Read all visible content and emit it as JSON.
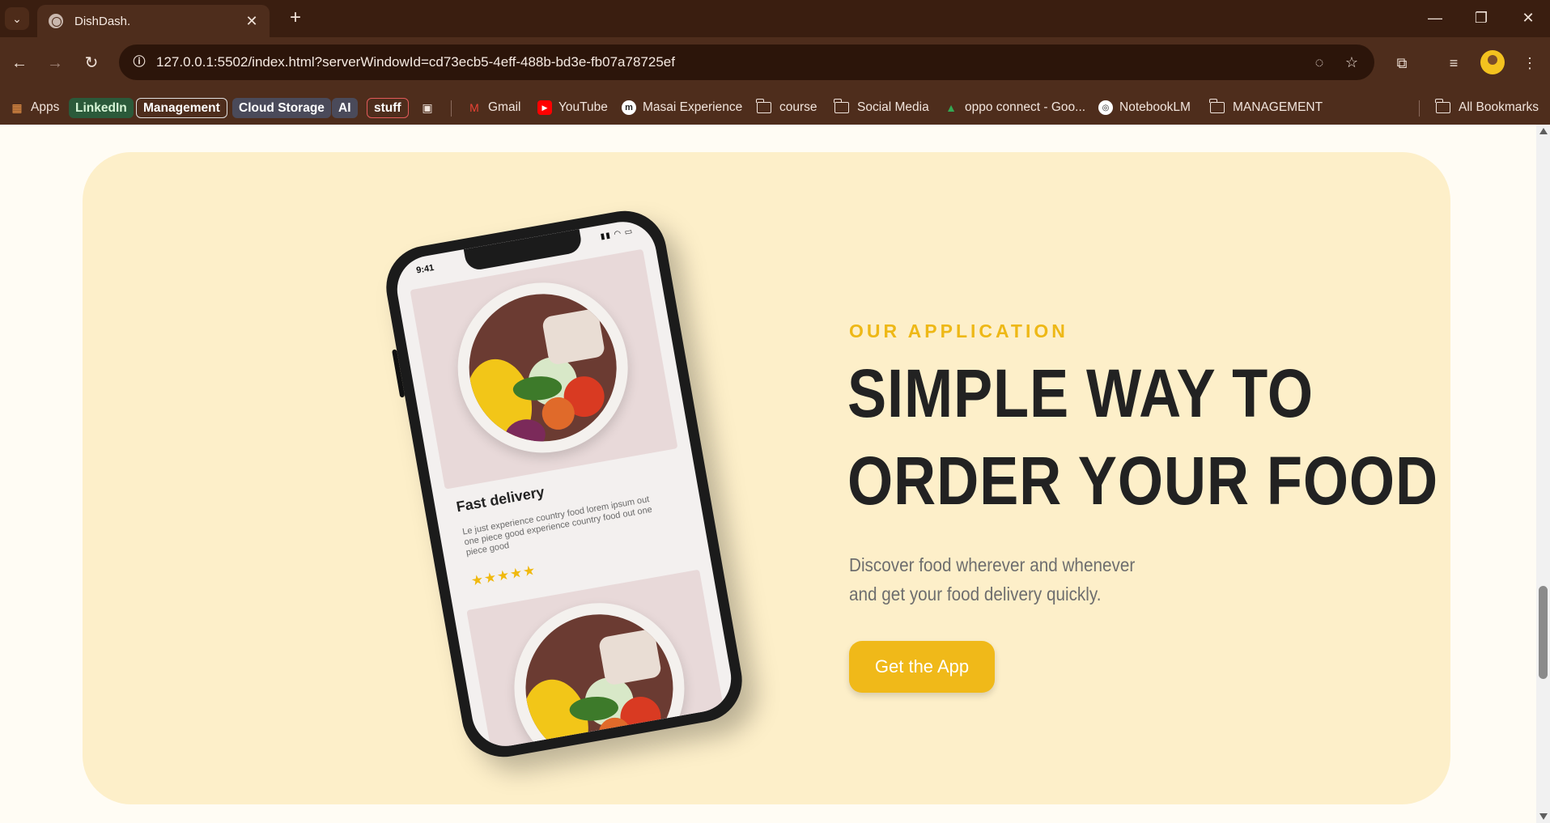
{
  "browser": {
    "tab": {
      "title": "DishDash.",
      "favicon": "globe-icon"
    },
    "url": "127.0.0.1:5502/index.html?serverWindowId=cd73ecb5-4eff-488b-bd3e-fb07a78725ef",
    "bookmarks": {
      "apps": "Apps",
      "linkedin": "LinkedIn",
      "management": "Management",
      "cloud_storage": "Cloud Storage",
      "ai": "AI",
      "stuff": "stuff",
      "gmail": "Gmail",
      "youtube": "YouTube",
      "masai": "Masai Experience",
      "course": "course",
      "social_media": "Social Media",
      "oppo": "oppo connect - Goo...",
      "notebooklm": "NotebookLM",
      "management_folder": "MANAGEMENT",
      "all_bookmarks": "All Bookmarks"
    },
    "colors": {
      "frame": "#3a1e10",
      "toolbar": "#4e2d1c",
      "omnibox": "#2c150a"
    }
  },
  "app_section": {
    "eyebrow": "OUR APPLICATION",
    "headline_line1": "SIMPLE WAY TO",
    "headline_line2": "ORDER YOUR FOOD",
    "subtext_line1": "Discover food wherever and whenever",
    "subtext_line2": "and get your food delivery quickly.",
    "cta_label": "Get the App",
    "colors": {
      "card_bg": "#fdefc9",
      "accent": "#f0b919",
      "heading": "#222222"
    }
  },
  "phone": {
    "status_time": "9:41",
    "card_title": "Fast delivery",
    "card_desc": "Le just experience country food lorem ipsum out one piece good experience country food out one piece good",
    "stars": "★★★★★",
    "rating": 5
  }
}
